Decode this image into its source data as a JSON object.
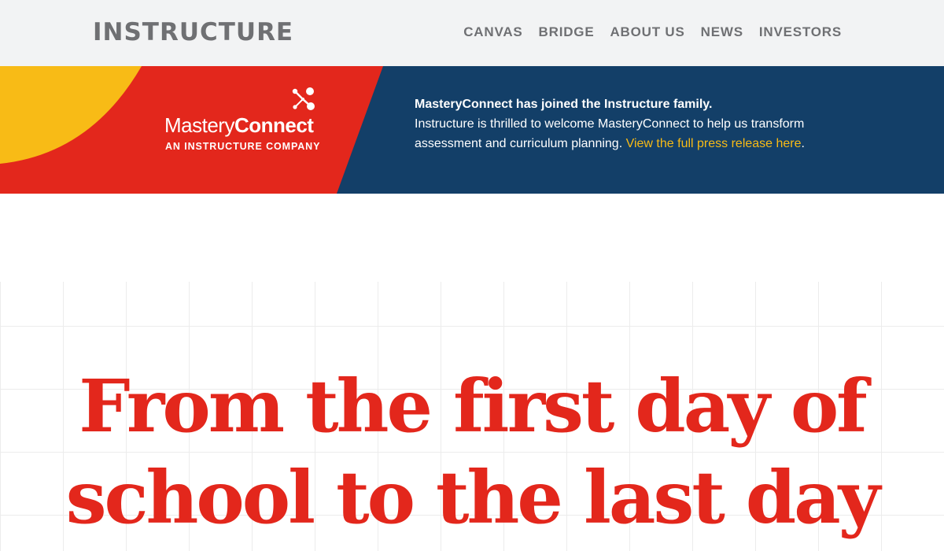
{
  "header": {
    "logo_text": "INSTRUCTURE",
    "nav": [
      {
        "label": "CANVAS"
      },
      {
        "label": "BRIDGE"
      },
      {
        "label": "ABOUT US"
      },
      {
        "label": "NEWS"
      },
      {
        "label": "INVESTORS"
      }
    ]
  },
  "banner": {
    "logo": {
      "word_light": "Mastery",
      "word_bold": "Connect",
      "tagline": "AN INSTRUCTURE COMPANY",
      "icon": "masteryconnect-dots-icon"
    },
    "headline": "MasteryConnect has joined the Instructure family.",
    "body": "Instructure is thrilled to welcome MasteryConnect to help us transform assessment and curriculum planning.",
    "link_text": "View the full press release here",
    "trailing": "."
  },
  "hero": {
    "title": "From the first day of school to the last day"
  },
  "colors": {
    "header_bg": "#f2f3f4",
    "nav_text": "#6f7073",
    "banner_navy": "#133f68",
    "banner_red": "#e3271c",
    "banner_yellow": "#f8bb16",
    "link_yellow": "#f8bb16",
    "hero_red": "#e3271c"
  }
}
